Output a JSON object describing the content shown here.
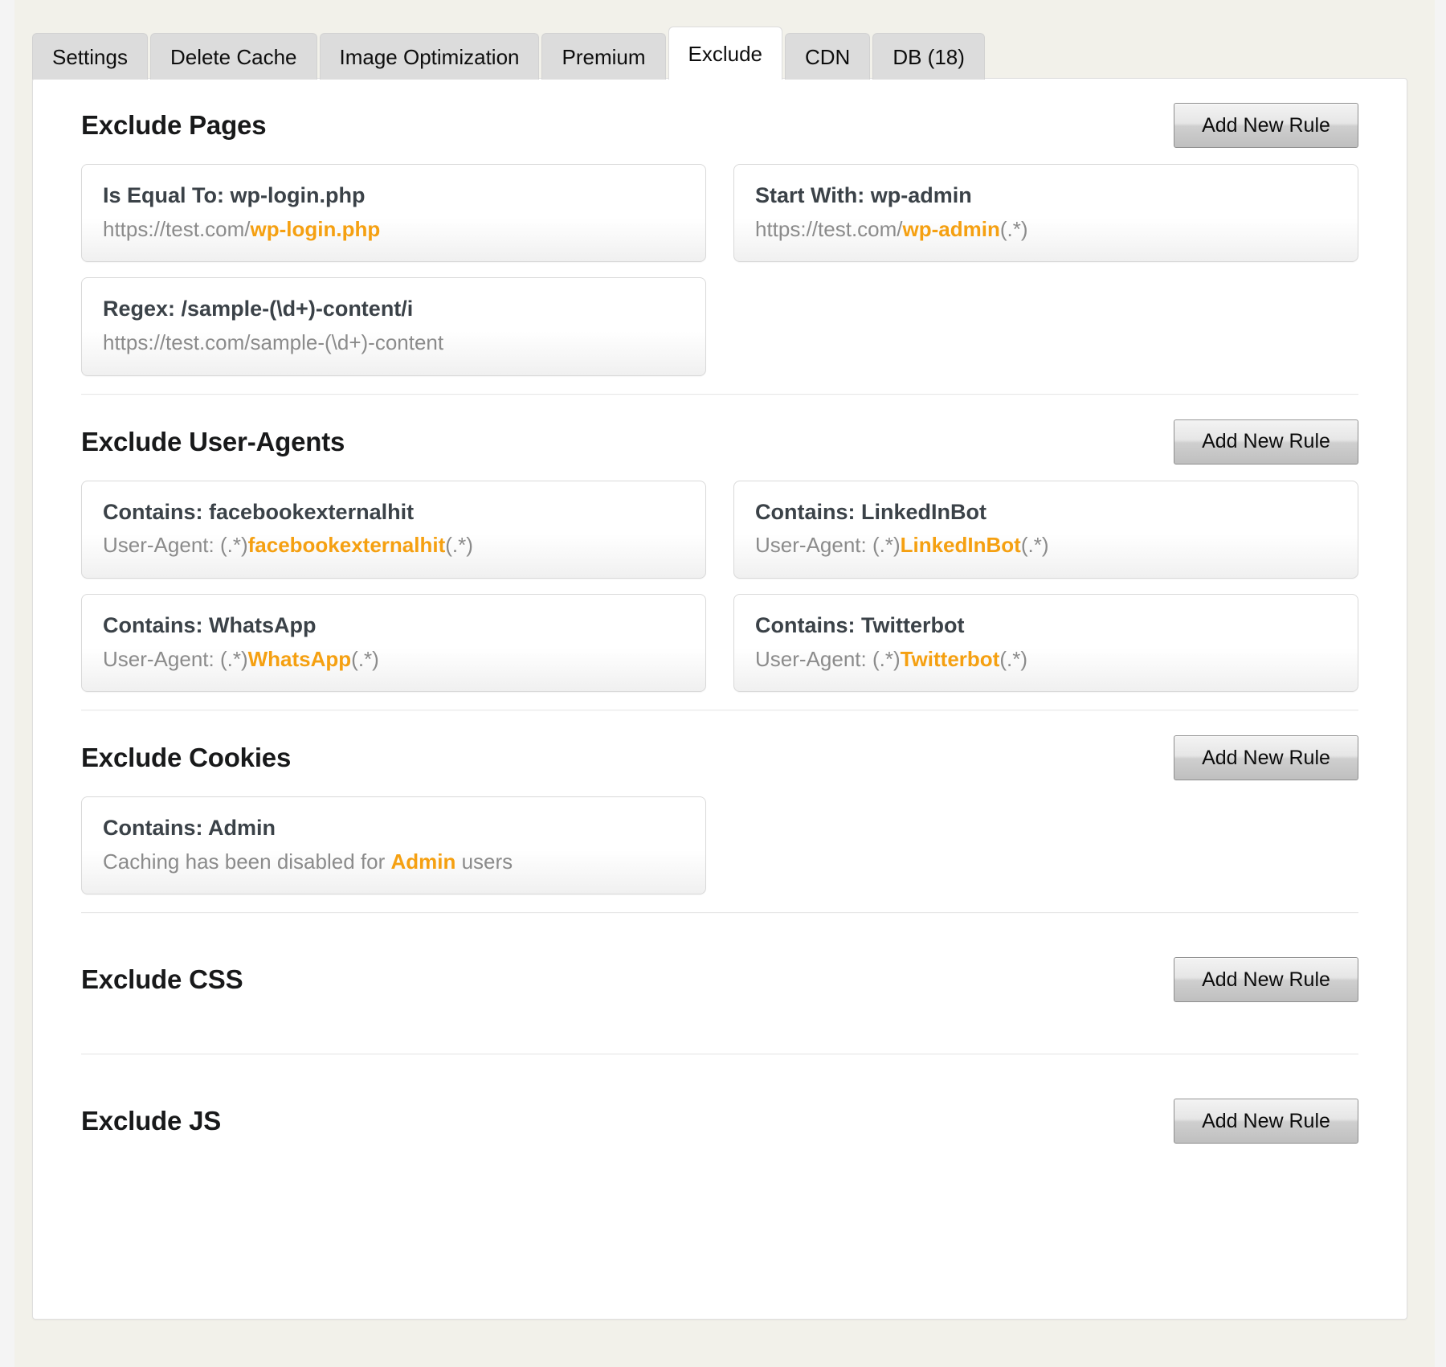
{
  "tabs": [
    {
      "label": "Settings",
      "active": false
    },
    {
      "label": "Delete Cache",
      "active": false
    },
    {
      "label": "Image Optimization",
      "active": false
    },
    {
      "label": "Premium",
      "active": false
    },
    {
      "label": "Exclude",
      "active": true
    },
    {
      "label": "CDN",
      "active": false
    },
    {
      "label": "DB (18)",
      "active": false
    }
  ],
  "colors": {
    "accent": "#f5a011",
    "title": "#3b4248",
    "muted": "#8b8b8b",
    "page_bg": "#f2f1ea",
    "panel_bg": "#ffffff"
  },
  "add_button_label": "Add New Rule",
  "sections": [
    {
      "id": "exclude-pages",
      "title": "Exclude Pages",
      "add_label": "Add New Rule",
      "rules": [
        {
          "title": "Is Equal To: wp-login.php",
          "sub_prefix": "https://test.com/",
          "sub_highlight": "wp-login.php",
          "sub_suffix": ""
        },
        {
          "title": "Start With: wp-admin",
          "sub_prefix": "https://test.com/",
          "sub_highlight": "wp-admin",
          "sub_suffix": "(.*)"
        },
        {
          "title": "Regex: /sample-(\\d+)-content/i",
          "sub_prefix": "https://test.com/sample-(\\d+)-content",
          "sub_highlight": "",
          "sub_suffix": ""
        }
      ]
    },
    {
      "id": "exclude-user-agents",
      "title": "Exclude User-Agents",
      "add_label": "Add New Rule",
      "rules": [
        {
          "title": "Contains: facebookexternalhit",
          "sub_prefix": "User-Agent: (.*)",
          "sub_highlight": "facebookexternalhit",
          "sub_suffix": "(.*)"
        },
        {
          "title": "Contains: LinkedInBot",
          "sub_prefix": "User-Agent: (.*)",
          "sub_highlight": "LinkedInBot",
          "sub_suffix": "(.*)"
        },
        {
          "title": "Contains: WhatsApp",
          "sub_prefix": "User-Agent: (.*)",
          "sub_highlight": "WhatsApp",
          "sub_suffix": "(.*)"
        },
        {
          "title": "Contains: Twitterbot",
          "sub_prefix": "User-Agent: (.*)",
          "sub_highlight": "Twitterbot",
          "sub_suffix": "(.*)"
        }
      ]
    },
    {
      "id": "exclude-cookies",
      "title": "Exclude Cookies",
      "add_label": "Add New Rule",
      "rules": [
        {
          "title": "Contains: Admin",
          "sub_prefix": "Caching has been disabled for ",
          "sub_highlight": "Admin",
          "sub_suffix": " users"
        }
      ]
    },
    {
      "id": "exclude-css",
      "title": "Exclude CSS",
      "add_label": "Add New Rule",
      "rules": []
    },
    {
      "id": "exclude-js",
      "title": "Exclude JS",
      "add_label": "Add New Rule",
      "rules": []
    }
  ]
}
